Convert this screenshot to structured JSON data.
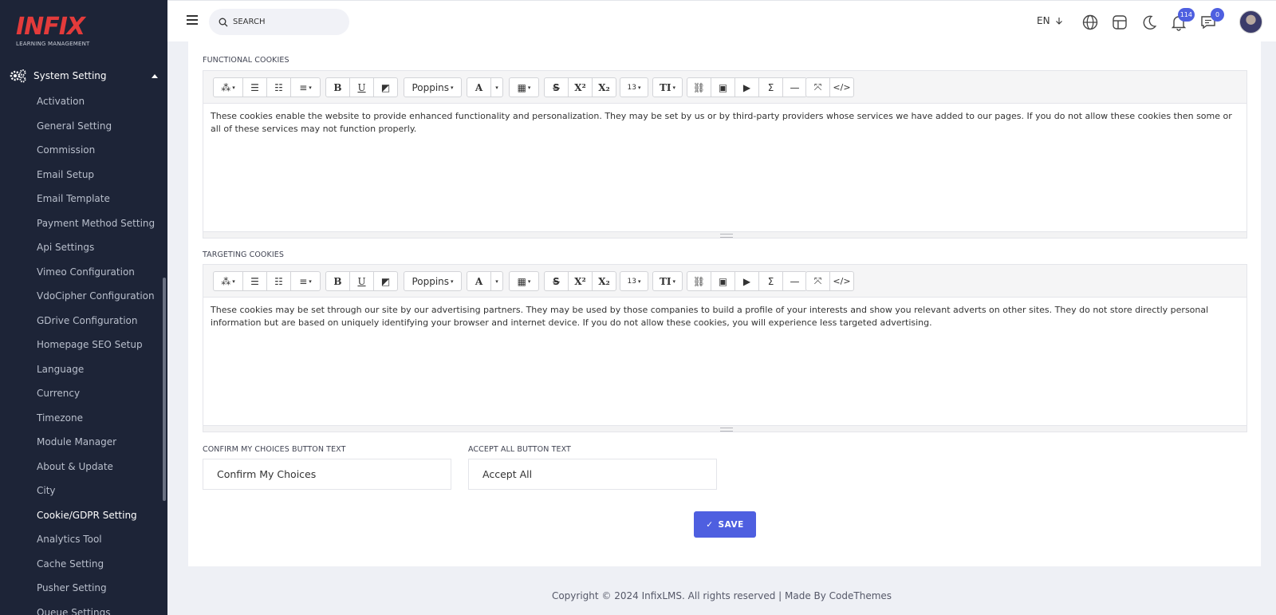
{
  "app": {
    "logo_text": "INFIX",
    "logo_subtitle": "LEARNING MANAGEMENT"
  },
  "sidebar": {
    "section_label": "System Setting",
    "items": [
      {
        "label": "Activation"
      },
      {
        "label": "General Setting"
      },
      {
        "label": "Commission"
      },
      {
        "label": "Email Setup"
      },
      {
        "label": "Email Template"
      },
      {
        "label": "Payment Method Setting"
      },
      {
        "label": "Api Settings"
      },
      {
        "label": "Vimeo Configuration"
      },
      {
        "label": "VdoCipher Configuration"
      },
      {
        "label": "GDrive Configuration"
      },
      {
        "label": "Homepage SEO Setup"
      },
      {
        "label": "Language"
      },
      {
        "label": "Currency"
      },
      {
        "label": "Timezone"
      },
      {
        "label": "Module Manager"
      },
      {
        "label": "About & Update"
      },
      {
        "label": "City"
      },
      {
        "label": "Cookie/GDPR Setting",
        "active": true
      },
      {
        "label": "Analytics Tool"
      },
      {
        "label": "Cache Setting"
      },
      {
        "label": "Pusher Setting"
      },
      {
        "label": "Queue Settings"
      }
    ]
  },
  "header": {
    "search_placeholder": "SEARCH",
    "language": "EN",
    "notifications_count": "114",
    "messages_count": "0"
  },
  "form": {
    "functional": {
      "label": "FUNCTIONAL COOKIES",
      "font": "Poppins",
      "font_size": "13",
      "text": "These cookies enable the website to provide enhanced functionality and personalization. They may be set by us or by third-party providers whose services we have added to our pages. If you do not allow these cookies then some or all of these services may not function properly."
    },
    "targeting": {
      "label": "TARGETING COOKIES",
      "font": "Poppins",
      "font_size": "13",
      "text": "These cookies may be set through our site by our advertising partners. They may be used by those companies to build a profile of your interests and show you relevant adverts on other sites. They do not store directly personal information but are based on uniquely identifying your browser and internet device. If you do not allow these cookies, you will experience less targeted advertising."
    },
    "confirm_label": "CONFIRM MY CHOICES BUTTON TEXT",
    "confirm_value": "Confirm My Choices",
    "accept_label": "ACCEPT ALL BUTTON TEXT",
    "accept_value": "Accept All",
    "save_label": "SAVE"
  },
  "footer": {
    "text": "Copyright © 2024 InfixLMS. All rights reserved | Made By CodeThemes"
  },
  "colors": {
    "sidebar_bg": "#1d2437",
    "accent": "#4e5fe0",
    "logo_red": "#e33b3b"
  }
}
